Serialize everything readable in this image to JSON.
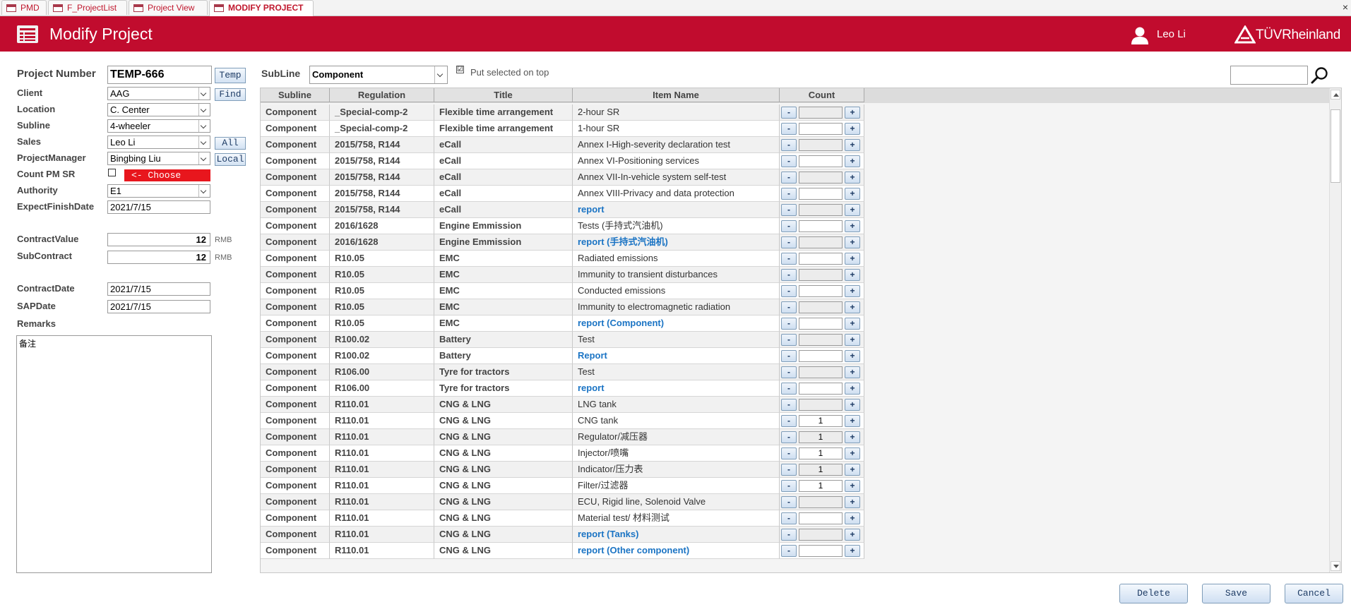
{
  "tabs": [
    {
      "label": "PMD"
    },
    {
      "label": "F_ProjectList"
    },
    {
      "label": "Project View"
    },
    {
      "label": "MODIFY PROJECT"
    }
  ],
  "close_glyph": "×",
  "header": {
    "title": "Modify Project",
    "user": "Leo Li",
    "brand": "TÜVRheinland"
  },
  "form": {
    "project_number": {
      "label": "Project Number",
      "value": "TEMP-666"
    },
    "client": {
      "label": "Client",
      "value": "AAG"
    },
    "location": {
      "label": "Location",
      "value": "C. Center"
    },
    "subline": {
      "label": "Subline",
      "value": "4-wheeler"
    },
    "sales": {
      "label": "Sales",
      "value": "Leo Li"
    },
    "project_manager": {
      "label": "ProjectManager",
      "value": "Bingbing Liu"
    },
    "count_pm_sr": {
      "label": "Count PM SR",
      "checked": false
    },
    "authority": {
      "label": "Authority",
      "value": "E1"
    },
    "expect_finish_date": {
      "label": "ExpectFinishDate",
      "value": "2021/7/15"
    },
    "contract_value": {
      "label": "ContractValue",
      "value": "12",
      "unit": "RMB"
    },
    "sub_contract": {
      "label": "SubContract",
      "value": "12",
      "unit": "RMB"
    },
    "contract_date": {
      "label": "ContractDate",
      "value": "2021/7/15"
    },
    "sap_date": {
      "label": "SAPDate",
      "value": "2021/7/15"
    },
    "remarks": {
      "label": "Remarks",
      "value": "备注"
    }
  },
  "side_buttons": {
    "temp": "Temp",
    "find": "Find",
    "all": "All",
    "local": "Local",
    "choose": "<- Choose"
  },
  "filter": {
    "subline_label": "SubLine",
    "subline_value": "Component",
    "put_on_top_label": "Put selected on top",
    "put_on_top_checked": true,
    "checkmark": "☑"
  },
  "grid": {
    "columns": [
      "Subline",
      "Regulation",
      "Title",
      "Item Name",
      "Count"
    ],
    "minus": "-",
    "plus": "+",
    "rows": [
      {
        "subline": "Component",
        "regulation": "_Special-comp-2",
        "title": "Flexible time arrangement",
        "item": "2-hour SR",
        "count": "",
        "report": false
      },
      {
        "subline": "Component",
        "regulation": "_Special-comp-2",
        "title": "Flexible time arrangement",
        "item": "1-hour SR",
        "count": "",
        "report": false
      },
      {
        "subline": "Component",
        "regulation": "2015/758, R144",
        "title": "eCall",
        "item": "Annex I-High-severity declaration test",
        "count": "",
        "report": false
      },
      {
        "subline": "Component",
        "regulation": "2015/758, R144",
        "title": "eCall",
        "item": "Annex VI-Positioning services",
        "count": "",
        "report": false
      },
      {
        "subline": "Component",
        "regulation": "2015/758, R144",
        "title": "eCall",
        "item": "Annex VII-In-vehicle system self-test",
        "count": "",
        "report": false
      },
      {
        "subline": "Component",
        "regulation": "2015/758, R144",
        "title": "eCall",
        "item": "Annex VIII-Privacy and data protection",
        "count": "",
        "report": false
      },
      {
        "subline": "Component",
        "regulation": "2015/758, R144",
        "title": "eCall",
        "item": "report",
        "count": "",
        "report": true
      },
      {
        "subline": "Component",
        "regulation": "2016/1628",
        "title": "Engine Emmission",
        "item": "Tests (手持式汽油机)",
        "count": "",
        "report": false
      },
      {
        "subline": "Component",
        "regulation": "2016/1628",
        "title": "Engine Emmission",
        "item": "report (手持式汽油机)",
        "count": "",
        "report": true
      },
      {
        "subline": "Component",
        "regulation": "R10.05",
        "title": "EMC",
        "item": "Radiated emissions",
        "count": "",
        "report": false
      },
      {
        "subline": "Component",
        "regulation": "R10.05",
        "title": "EMC",
        "item": "Immunity to transient disturbances",
        "count": "",
        "report": false
      },
      {
        "subline": "Component",
        "regulation": "R10.05",
        "title": "EMC",
        "item": "Conducted emissions",
        "count": "",
        "report": false
      },
      {
        "subline": "Component",
        "regulation": "R10.05",
        "title": "EMC",
        "item": "Immunity to electromagnetic radiation",
        "count": "",
        "report": false
      },
      {
        "subline": "Component",
        "regulation": "R10.05",
        "title": "EMC",
        "item": "report (Component)",
        "count": "",
        "report": true
      },
      {
        "subline": "Component",
        "regulation": "R100.02",
        "title": "Battery",
        "item": "Test",
        "count": "",
        "report": false
      },
      {
        "subline": "Component",
        "regulation": "R100.02",
        "title": "Battery",
        "item": "Report",
        "count": "",
        "report": true
      },
      {
        "subline": "Component",
        "regulation": "R106.00",
        "title": "Tyre for tractors",
        "item": "Test",
        "count": "",
        "report": false
      },
      {
        "subline": "Component",
        "regulation": "R106.00",
        "title": "Tyre for tractors",
        "item": "report",
        "count": "",
        "report": true
      },
      {
        "subline": "Component",
        "regulation": "R110.01",
        "title": "CNG & LNG",
        "item": "LNG tank",
        "count": "",
        "report": false
      },
      {
        "subline": "Component",
        "regulation": "R110.01",
        "title": "CNG & LNG",
        "item": "CNG tank",
        "count": "1",
        "report": false
      },
      {
        "subline": "Component",
        "regulation": "R110.01",
        "title": "CNG & LNG",
        "item": "Regulator/减压器",
        "count": "1",
        "report": false
      },
      {
        "subline": "Component",
        "regulation": "R110.01",
        "title": "CNG & LNG",
        "item": "Injector/喷嘴",
        "count": "1",
        "report": false
      },
      {
        "subline": "Component",
        "regulation": "R110.01",
        "title": "CNG & LNG",
        "item": "Indicator/压力表",
        "count": "1",
        "report": false
      },
      {
        "subline": "Component",
        "regulation": "R110.01",
        "title": "CNG & LNG",
        "item": "Filter/过滤器",
        "count": "1",
        "report": false
      },
      {
        "subline": "Component",
        "regulation": "R110.01",
        "title": "CNG & LNG",
        "item": "ECU, Rigid line, Solenoid Valve",
        "count": "",
        "report": false
      },
      {
        "subline": "Component",
        "regulation": "R110.01",
        "title": "CNG & LNG",
        "item": "Material test/ 材料测试",
        "count": "",
        "report": false
      },
      {
        "subline": "Component",
        "regulation": "R110.01",
        "title": "CNG & LNG",
        "item": "report (Tanks)",
        "count": "",
        "report": true
      },
      {
        "subline": "Component",
        "regulation": "R110.01",
        "title": "CNG & LNG",
        "item": "report (Other component)",
        "count": "",
        "report": true
      }
    ]
  },
  "actions": {
    "delete": "Delete",
    "save": "Save",
    "cancel": "Cancel"
  },
  "colors": {
    "brand_red": "#c10c2e",
    "choose_red": "#e8161d",
    "report_blue": "#1b74c4"
  },
  "icons": {
    "header": "form-icon",
    "user": "user-icon",
    "logo": "tuv-triangle-icon",
    "search": "search-icon",
    "tab": "form-tab-icon"
  }
}
